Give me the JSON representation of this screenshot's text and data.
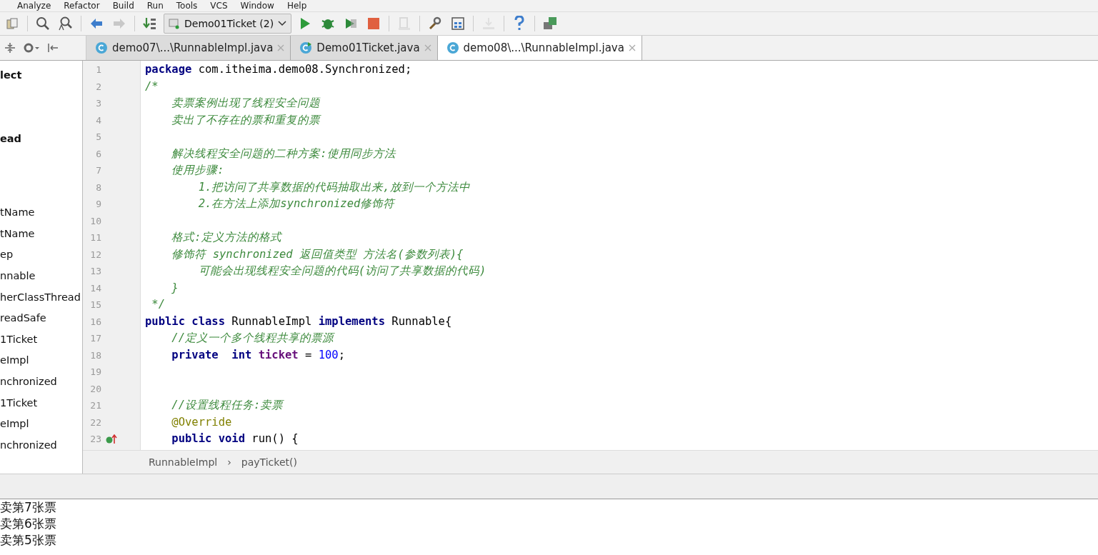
{
  "menu": [
    "Analyze",
    "Refactor",
    "Build",
    "Run",
    "Tools",
    "VCS",
    "Window",
    "Help"
  ],
  "toolbar": {
    "left_icons": [
      {
        "kind": "copy"
      },
      {
        "kind": "search"
      },
      {
        "kind": "search-replace"
      },
      {
        "kind": "back"
      },
      {
        "kind": "forward"
      },
      {
        "kind": "sort"
      }
    ],
    "run_config": "Demo01Ticket (2)",
    "right_icons": [
      {
        "kind": "run",
        "disabled": false
      },
      {
        "kind": "debug",
        "disabled": false
      },
      {
        "kind": "coverage",
        "disabled": false
      },
      {
        "kind": "stop",
        "disabled": false
      },
      {
        "kind": "build",
        "disabled": true
      },
      {
        "kind": "settings",
        "disabled": false
      },
      {
        "kind": "structure",
        "disabled": false
      },
      {
        "kind": "download",
        "disabled": true
      },
      {
        "kind": "help",
        "disabled": false
      },
      {
        "kind": "sdk",
        "disabled": false
      }
    ]
  },
  "tabs": [
    {
      "label": "demo07\\...\\RunnableImpl.java",
      "selected": false,
      "running": false
    },
    {
      "label": "Demo01Ticket.java",
      "selected": false,
      "running": true
    },
    {
      "label": "demo08\\...\\RunnableImpl.java",
      "selected": true,
      "running": false
    }
  ],
  "project_tree": [
    {
      "label": "lect",
      "bold": true
    },
    {
      "label": "ead",
      "bold": true
    },
    {
      "label": "tName",
      "bold": false
    },
    {
      "label": "tName",
      "bold": false
    },
    {
      "label": "ep",
      "bold": false
    },
    {
      "label": "nnable",
      "bold": false
    },
    {
      "label": "herClassThread",
      "bold": false
    },
    {
      "label": "readSafe",
      "bold": false
    },
    {
      "label": "1Ticket",
      "bold": false
    },
    {
      "label": "eImpl",
      "bold": false
    },
    {
      "label": "nchronized",
      "bold": false
    },
    {
      "label": "1Ticket",
      "bold": false
    },
    {
      "label": "eImpl",
      "bold": false
    },
    {
      "label": "nchronized",
      "bold": false
    }
  ],
  "editor": {
    "lines": [
      {
        "number": "1",
        "marker": false,
        "segments": [
          {
            "kind": "keyword",
            "text": "package"
          },
          {
            "kind": "plain",
            "text": " com.itheima.demo08.Synchronized;"
          }
        ]
      },
      {
        "number": "2",
        "marker": false,
        "segments": [
          {
            "kind": "comment",
            "text": "/*"
          }
        ]
      },
      {
        "number": "3",
        "marker": false,
        "segments": [
          {
            "kind": "comment",
            "text": "    卖票案例出现了线程安全问题"
          }
        ]
      },
      {
        "number": "4",
        "marker": false,
        "segments": [
          {
            "kind": "comment",
            "text": "    卖出了不存在的票和重复的票"
          }
        ]
      },
      {
        "number": "5",
        "marker": false
      },
      {
        "number": "6",
        "marker": false,
        "segments": [
          {
            "kind": "comment",
            "text": "    解决线程安全问题的二种方案:使用同步方法"
          }
        ]
      },
      {
        "number": "7",
        "marker": false,
        "segments": [
          {
            "kind": "comment",
            "text": "    使用步骤:"
          }
        ]
      },
      {
        "number": "8",
        "marker": false,
        "segments": [
          {
            "kind": "comment",
            "text": "        1.把访问了共享数据的代码抽取出来,放到一个方法中"
          }
        ]
      },
      {
        "number": "9",
        "marker": false,
        "segments": [
          {
            "kind": "comment",
            "text": "        2.在方法上添加synchronized修饰符"
          }
        ]
      },
      {
        "number": "10",
        "marker": false
      },
      {
        "number": "11",
        "marker": false,
        "segments": [
          {
            "kind": "comment",
            "text": "    格式:定义方法的格式"
          }
        ]
      },
      {
        "number": "12",
        "marker": false,
        "segments": [
          {
            "kind": "comment",
            "text": "    修饰符 synchronized 返回值类型 方法名(参数列表){"
          }
        ]
      },
      {
        "number": "13",
        "marker": false,
        "segments": [
          {
            "kind": "comment",
            "text": "        可能会出现线程安全问题的代码(访问了共享数据的代码)"
          }
        ]
      },
      {
        "number": "14",
        "marker": false,
        "segments": [
          {
            "kind": "comment",
            "text": "    }"
          }
        ]
      },
      {
        "number": "15",
        "marker": false,
        "segments": [
          {
            "kind": "comment",
            "text": " */"
          }
        ]
      },
      {
        "number": "16",
        "marker": false,
        "segments": [
          {
            "kind": "keyword",
            "text": "public class"
          },
          {
            "kind": "plain",
            "text": " RunnableImpl "
          },
          {
            "kind": "keyword",
            "text": "implements"
          },
          {
            "kind": "plain",
            "text": " Runnable{"
          }
        ]
      },
      {
        "number": "17",
        "marker": false,
        "segments": [
          {
            "kind": "comment",
            "text": "    //定义一个多个线程共享的票源"
          }
        ]
      },
      {
        "number": "18",
        "marker": false,
        "segments": [
          {
            "kind": "keyword",
            "text": "    private  int "
          },
          {
            "kind": "field",
            "text": "ticket"
          },
          {
            "kind": "plain",
            "text": " = "
          },
          {
            "kind": "number",
            "text": "100"
          },
          {
            "kind": "plain",
            "text": ";"
          }
        ]
      },
      {
        "number": "19",
        "marker": false
      },
      {
        "number": "20",
        "marker": false
      },
      {
        "number": "21",
        "marker": false,
        "segments": [
          {
            "kind": "comment",
            "text": "    //设置线程任务:卖票"
          }
        ]
      },
      {
        "number": "22",
        "marker": false,
        "segments": [
          {
            "kind": "annotation",
            "text": "    @Override"
          }
        ]
      },
      {
        "number": "23",
        "marker": true,
        "segments": [
          {
            "kind": "keyword",
            "text": "    public void"
          },
          {
            "kind": "plain",
            "text": " run() {"
          }
        ]
      }
    ]
  },
  "breadcrumb": [
    {
      "text": "RunnableImpl"
    },
    {
      "text": "›"
    },
    {
      "text": "payTicket()"
    }
  ],
  "console": [
    "卖第7张票",
    "卖第6张票",
    "卖第5张票"
  ]
}
